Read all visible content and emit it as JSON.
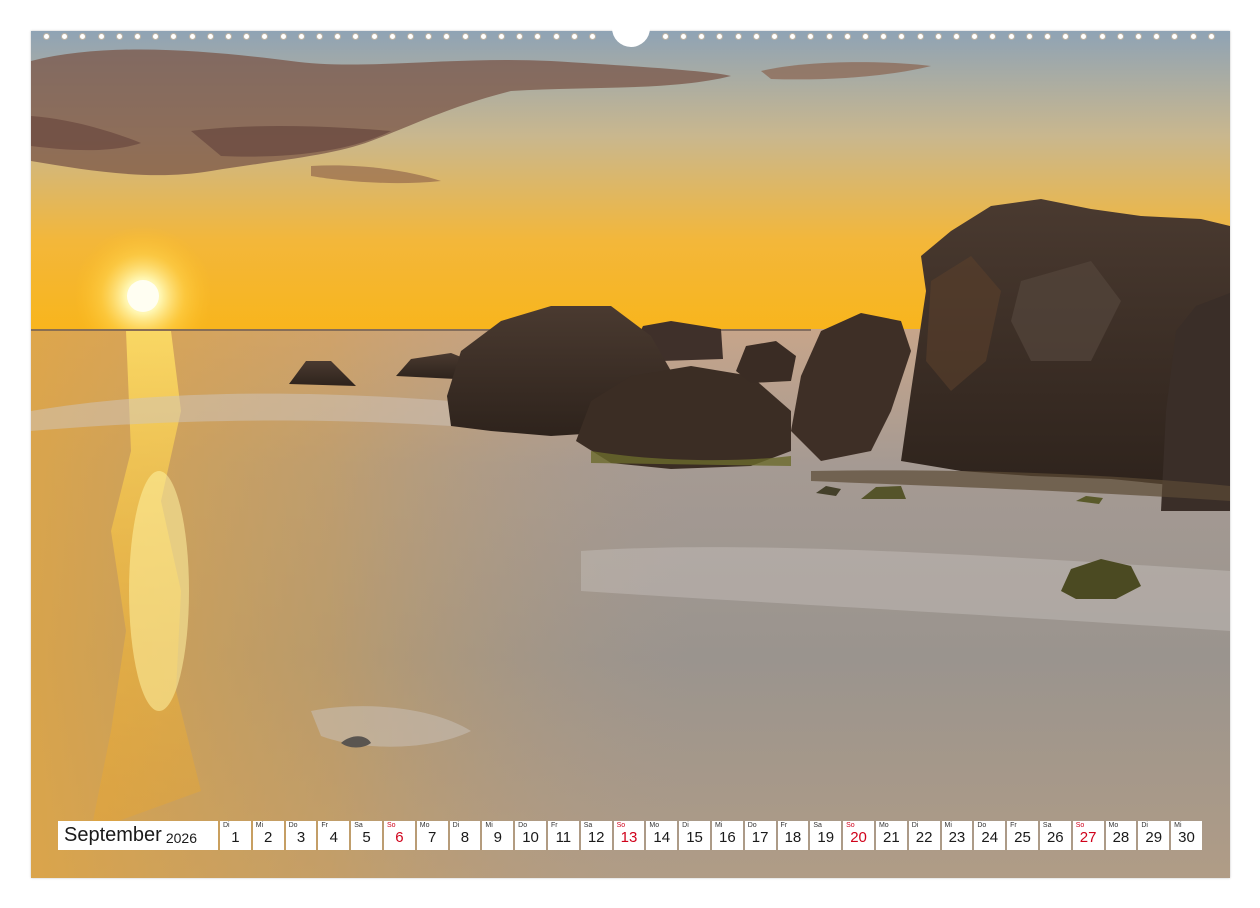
{
  "calendar": {
    "month": "September",
    "year": "2026",
    "days": [
      {
        "abbr": "Di",
        "num": "1",
        "sunday": false
      },
      {
        "abbr": "Mi",
        "num": "2",
        "sunday": false
      },
      {
        "abbr": "Do",
        "num": "3",
        "sunday": false
      },
      {
        "abbr": "Fr",
        "num": "4",
        "sunday": false
      },
      {
        "abbr": "Sa",
        "num": "5",
        "sunday": false
      },
      {
        "abbr": "So",
        "num": "6",
        "sunday": true
      },
      {
        "abbr": "Mo",
        "num": "7",
        "sunday": false
      },
      {
        "abbr": "Di",
        "num": "8",
        "sunday": false
      },
      {
        "abbr": "Mi",
        "num": "9",
        "sunday": false
      },
      {
        "abbr": "Do",
        "num": "10",
        "sunday": false
      },
      {
        "abbr": "Fr",
        "num": "11",
        "sunday": false
      },
      {
        "abbr": "Sa",
        "num": "12",
        "sunday": false
      },
      {
        "abbr": "So",
        "num": "13",
        "sunday": true
      },
      {
        "abbr": "Mo",
        "num": "14",
        "sunday": false
      },
      {
        "abbr": "Di",
        "num": "15",
        "sunday": false
      },
      {
        "abbr": "Mi",
        "num": "16",
        "sunday": false
      },
      {
        "abbr": "Do",
        "num": "17",
        "sunday": false
      },
      {
        "abbr": "Fr",
        "num": "18",
        "sunday": false
      },
      {
        "abbr": "Sa",
        "num": "19",
        "sunday": false
      },
      {
        "abbr": "So",
        "num": "20",
        "sunday": true
      },
      {
        "abbr": "Mo",
        "num": "21",
        "sunday": false
      },
      {
        "abbr": "Di",
        "num": "22",
        "sunday": false
      },
      {
        "abbr": "Mi",
        "num": "23",
        "sunday": false
      },
      {
        "abbr": "Do",
        "num": "24",
        "sunday": false
      },
      {
        "abbr": "Fr",
        "num": "25",
        "sunday": false
      },
      {
        "abbr": "Sa",
        "num": "26",
        "sunday": false
      },
      {
        "abbr": "So",
        "num": "27",
        "sunday": true
      },
      {
        "abbr": "Mo",
        "num": "28",
        "sunday": false
      },
      {
        "abbr": "Di",
        "num": "29",
        "sunday": false
      },
      {
        "abbr": "Mi",
        "num": "30",
        "sunday": false
      }
    ]
  },
  "colors": {
    "sunday": "#d0021b",
    "sky_top": "#8fa3b5",
    "sky_horizon": "#f7b71e",
    "sea": "#9a948e",
    "rock": "#3a2c24"
  },
  "photo": {
    "subject_icon": "sunset-beach-photo"
  }
}
